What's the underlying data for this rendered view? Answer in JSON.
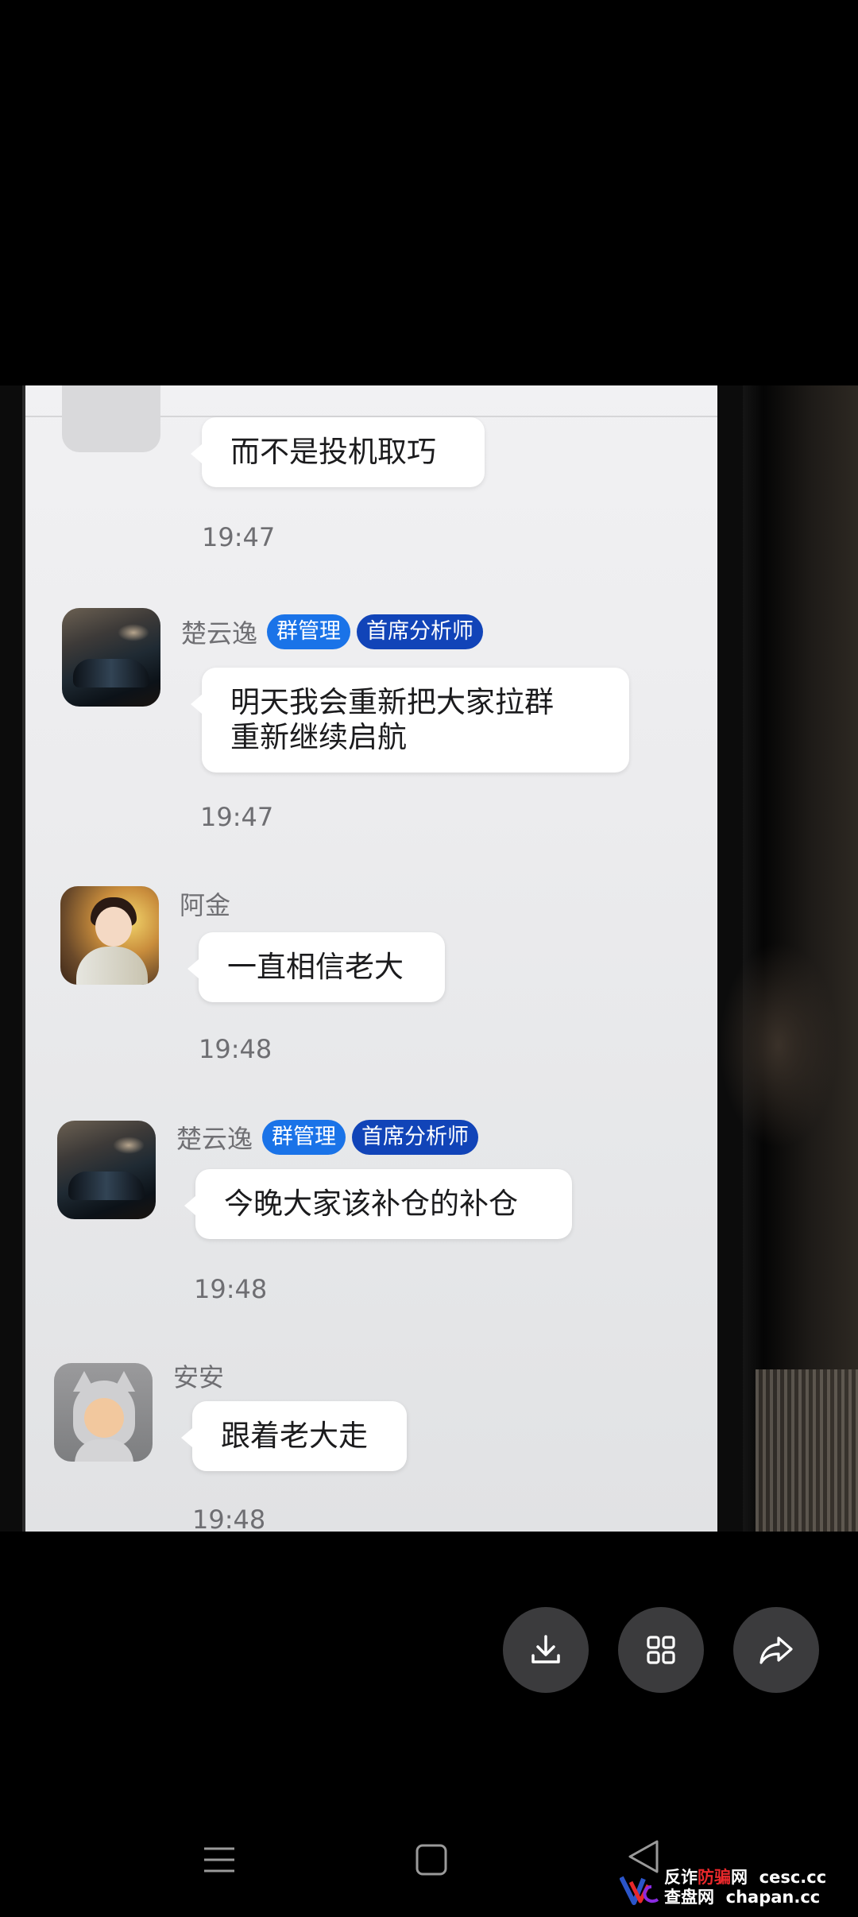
{
  "chat": {
    "messages": [
      {
        "sender": "",
        "badges": [],
        "lines": [
          "而不是投机取巧"
        ],
        "time": "19:47",
        "avatar": "partial-avatar"
      },
      {
        "sender": "楚云逸",
        "badges": [
          "群管理",
          "首席分析师"
        ],
        "lines": [
          "明天我会重新把大家拉群",
          "重新继续启航"
        ],
        "time": "19:47",
        "avatar": "car-avatar"
      },
      {
        "sender": "阿金",
        "badges": [],
        "lines": [
          "一直相信老大"
        ],
        "time": "19:48",
        "avatar": "girl-avatar"
      },
      {
        "sender": "楚云逸",
        "badges": [
          "群管理",
          "首席分析师"
        ],
        "lines": [
          "今晚大家该补仓的补仓"
        ],
        "time": "19:48",
        "avatar": "car-avatar"
      },
      {
        "sender": "安安",
        "badges": [],
        "lines": [
          "跟着老大走"
        ],
        "time": "19:48",
        "avatar": "cat-hood-avatar"
      }
    ]
  },
  "toolbar": {
    "buttons": [
      {
        "icon": "download-icon"
      },
      {
        "icon": "grid-icon"
      },
      {
        "icon": "share-icon"
      }
    ]
  },
  "navbar": {
    "icons": [
      "menu-icon",
      "home-icon",
      "back-icon"
    ]
  },
  "watermark": {
    "line1_a": "反诈",
    "line1_b": "防骗",
    "line1_c": "网",
    "line1_d": "cesc.cc",
    "line2_a": "查盘网",
    "line2_b": "chapan.cc"
  },
  "colors": {
    "badge_admin": "#1a73e8",
    "badge_analyst": "#1144b8",
    "toolbar_button": "#3b3b3d",
    "background": "#000000"
  }
}
